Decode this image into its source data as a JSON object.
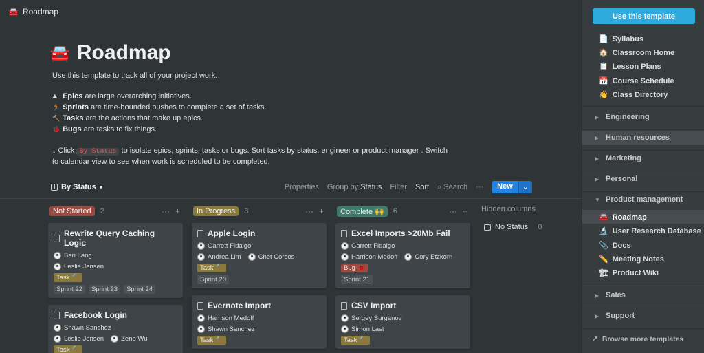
{
  "topbar": {
    "icon": "🚘",
    "title": "Roadmap"
  },
  "page": {
    "icon": "🚘",
    "title": "Roadmap",
    "intro": "Use this template to track all of your project work.",
    "bullets": [
      {
        "icon": "⛰",
        "term": "Epics",
        "rest": " are large overarching initiatives."
      },
      {
        "icon": "🏃",
        "term": "Sprints",
        "rest": " are time-bounded pushes to complete a set of tasks."
      },
      {
        "icon": "🔨",
        "term": "Tasks",
        "rest": " are the actions that make up epics."
      },
      {
        "icon": "🐞",
        "term": "Bugs",
        "rest": " are tasks to fix things."
      }
    ],
    "click_prefix": "↓ Click ",
    "click_code": "By Status",
    "click_line1_rest": " to isolate epics, sprints, tasks or bugs. Sort tasks by status, engineer or product manager . Switch",
    "click_line2": "to calendar view to see when work is scheduled to be completed."
  },
  "viewbar": {
    "view_name": "By Status",
    "properties": "Properties",
    "group_by_prefix": "Group by",
    "group_by_value": "Status",
    "filter": "Filter",
    "sort": "Sort",
    "search": "Search",
    "more": "···",
    "new": "New",
    "new_dropdown": "⌄"
  },
  "columns": [
    {
      "label": "Not Started",
      "count": "2",
      "tag_color": "#9b4a3f",
      "cards": [
        {
          "title": "Rewrite Query Caching Logic",
          "people_row1": [
            "Ben Lang"
          ],
          "people_row2": [
            "Leslie Jensen"
          ],
          "type": "Task 🔨",
          "type_kind": "task",
          "sprints": [
            "Sprint 22",
            "Sprint 23",
            "Sprint 24"
          ]
        },
        {
          "title": "Facebook Login",
          "people_row1": [
            "Shawn Sanchez"
          ],
          "people_row2": [
            "Leslie Jensen",
            "Zeno Wu"
          ],
          "type": "Task 🔨",
          "type_kind": "task",
          "sprints": []
        }
      ]
    },
    {
      "label": "In Progress",
      "count": "8",
      "tag_color": "#8a7a3b",
      "cards": [
        {
          "title": "Apple Login",
          "people_row1": [
            "Garrett Fidalgo"
          ],
          "people_row2": [
            "Andrea Lim",
            "Chet Corcos"
          ],
          "type": "Task 🔨",
          "type_kind": "task",
          "sprints": [
            "Sprint 20"
          ]
        },
        {
          "title": "Evernote Import",
          "people_row1": [
            "Harrison Medoff"
          ],
          "people_row2": [
            "Shawn Sanchez"
          ],
          "type": "Task 🔨",
          "type_kind": "task",
          "sprints": []
        }
      ]
    },
    {
      "label": "Complete 🙌",
      "count": "6",
      "tag_color": "#3f7a6a",
      "cards": [
        {
          "title": "Excel Imports >20Mb Fail",
          "people_row1": [
            "Garrett Fidalgo"
          ],
          "people_row2": [
            "Harrison Medoff",
            "Cory Etzkorn"
          ],
          "type": "Bug 🐞",
          "type_kind": "bug",
          "sprints": [
            "Sprint 21"
          ]
        },
        {
          "title": "CSV Import",
          "people_row1": [
            "Sergey Surganov"
          ],
          "people_row2": [
            "Simon Last"
          ],
          "type": "Task 🔨",
          "type_kind": "task",
          "sprints": []
        }
      ]
    }
  ],
  "hidden": {
    "title": "Hidden columns",
    "items": [
      {
        "label": "No Status",
        "count": "0"
      }
    ]
  },
  "sidebar": {
    "use_template": "Use this template",
    "links": [
      {
        "icon": "📄",
        "label": "Syllabus"
      },
      {
        "icon": "🏠",
        "label": "Classroom Home"
      },
      {
        "icon": "📋",
        "label": "Lesson Plans"
      },
      {
        "icon": "📅",
        "label": "Course Schedule"
      },
      {
        "icon": "👋",
        "label": "Class Directory"
      }
    ],
    "groups_top": [
      {
        "label": "Engineering",
        "expanded": false
      },
      {
        "label": "Human resources",
        "expanded": false,
        "highlight": true
      },
      {
        "label": "Marketing",
        "expanded": false
      },
      {
        "label": "Personal",
        "expanded": false
      },
      {
        "label": "Product management",
        "expanded": true
      }
    ],
    "pm_items": [
      {
        "icon": "🚘",
        "label": "Roadmap",
        "selected": true
      },
      {
        "icon": "🔬",
        "label": "User Research Database"
      },
      {
        "icon": "📎",
        "label": "Docs"
      },
      {
        "icon": "✏️",
        "label": "Meeting Notes"
      },
      {
        "icon": "🏗",
        "label": "Product Wiki"
      }
    ],
    "groups_bottom": [
      {
        "label": "Sales",
        "expanded": false
      },
      {
        "label": "Support",
        "expanded": false
      }
    ],
    "browse": "Browse more templates",
    "browse_icon": "↗"
  }
}
